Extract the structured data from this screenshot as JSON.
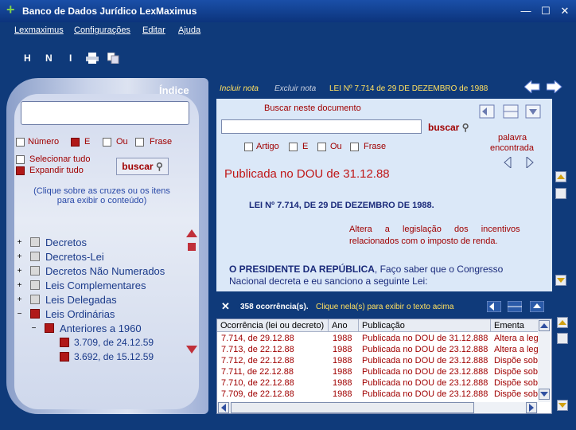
{
  "window": {
    "title": "Banco de Dados Jurídico LexMaximus",
    "min": "—",
    "max": "☐",
    "close": "✕"
  },
  "menu": [
    "Lexmaximus",
    "Configurações",
    "Editar",
    "Ajuda"
  ],
  "toolbar": [
    "H",
    "N",
    "I"
  ],
  "left": {
    "title": "Índice",
    "search_value": "",
    "options": {
      "numero": "Número",
      "e": "E",
      "ou": "Ou",
      "frase": "Frase"
    },
    "selecionar": "Selecionar tudo",
    "expandir": "Expandir tudo",
    "buscar": "buscar",
    "hint": "(Clique sobre as cruzes ou os itens para exibir o conteúdo)",
    "tree": [
      "Decretos",
      "Decretos-Lei",
      "Decretos Não Numerados",
      "Leis Complementares",
      "Leis Delegadas",
      "Leis Ordinárias"
    ],
    "sub": "Anteriores a 1960",
    "subsub": [
      "3.709, de 24.12.59",
      "3.692, de 15.12.59"
    ]
  },
  "header": {
    "incluir": "Incluir nota",
    "excluir": "Excluir nota",
    "lei": "LEI Nº 7.714 de 29 DE DEZEMBRO de 1988"
  },
  "doc": {
    "buscar_label": "Buscar neste documento",
    "buscar_btn": "buscar",
    "opts": {
      "artigo": "Artigo",
      "e": "E",
      "ou": "Ou",
      "frase": "Frase"
    },
    "palavra": "palavra",
    "encontrada": "encontrada",
    "publicada": "Publicada no DOU de 31.12.88",
    "lei_title": "LEI Nº 7.714, DE 29 DE DEZEMBRO DE 1988.",
    "ementa1": "Altera a legislação dos incentivos",
    "ementa2": "relacionados com o imposto de renda.",
    "presidente_bold": "O PRESIDENTE DA REPÚBLICA",
    "presidente_rest": ", Faço saber que o Congresso",
    "presidente2": "Nacional decreta e eu sanciono a seguinte Lei:"
  },
  "occ": {
    "count": "358 ocorrência(s).",
    "hint": "Clique nela(s) para exibir o texto acima"
  },
  "table": {
    "headers": [
      "Ocorrência (lei ou decreto)",
      "Ano",
      "Publicação",
      "Ementa"
    ],
    "rows": [
      [
        "7.714, de 29.12.88",
        "1988",
        "Publicada no DOU de 31.12.888",
        "Altera a leg"
      ],
      [
        "7.713, de 22.12.88",
        "1988",
        "Publicada no DOU de 23.12.888",
        "Altera a leg"
      ],
      [
        "7.712, de 22.12.88",
        "1988",
        "Publicada no DOU de 23.12.888",
        "Dispõe sobr"
      ],
      [
        "7.711, de 22.12.88",
        "1988",
        "Publicada no DOU de 23.12.888",
        "Dispõe sobr"
      ],
      [
        "7.710, de 22.12.88",
        "1988",
        "Publicada no DOU de 23.12.888",
        "Dispõe sobr"
      ],
      [
        "7.709, de 22.12.88",
        "1988",
        "Publicada no DOU de 23.12.888",
        "Dispõe sobr"
      ]
    ]
  }
}
